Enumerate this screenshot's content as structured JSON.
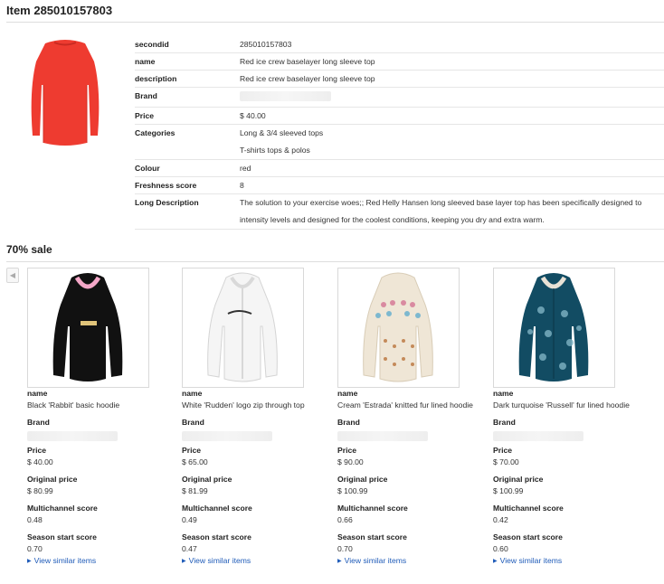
{
  "page": {
    "title": "Item 285010157803"
  },
  "item": {
    "rows": [
      {
        "key": "secondid",
        "value": "285010157803"
      },
      {
        "key": "name",
        "value": "Red ice crew baselayer long sleeve top"
      },
      {
        "key": "description",
        "value": "Red ice crew baselayer long sleeve top"
      },
      {
        "key": "Brand",
        "value": ""
      },
      {
        "key": "Price",
        "value": "$ 40.00"
      },
      {
        "key": "Categories",
        "value": "Long & 3/4 sleeved tops",
        "value2": "T-shirts tops & polos"
      },
      {
        "key": "Colour",
        "value": "red"
      },
      {
        "key": "Freshness score",
        "value": "8"
      },
      {
        "key": "Long Description",
        "value": "The solution to your exercise woes;; Red Helly Hansen long sleeved base layer top has been specifically designed to",
        "value2": "intensity levels and designed for the coolest conditions, keeping you dry and extra warm."
      }
    ]
  },
  "sale": {
    "title": "70% sale",
    "prev_icon": "left-arrow-icon",
    "labels": {
      "name": "name",
      "brand": "Brand",
      "price": "Price",
      "original_price": "Original price",
      "multichannel": "Multichannel score",
      "season": "Season start score",
      "similar": "View similar items"
    },
    "products": [
      {
        "name": "Black 'Rabbit' basic hoodie",
        "price": "$ 40.00",
        "original_price": "$ 80.99",
        "multichannel": "0.48",
        "season": "0.70",
        "color": "#111111",
        "accent": "#f4a7c8"
      },
      {
        "name": "White 'Rudden' logo zip through top",
        "price": "$ 65.00",
        "original_price": "$ 81.99",
        "multichannel": "0.49",
        "season": "0.47",
        "color": "#f5f5f5",
        "accent": "#d9d9d9"
      },
      {
        "name": "Cream 'Estrada' knitted fur lined hoodie",
        "price": "$ 90.00",
        "original_price": "$ 100.99",
        "multichannel": "0.66",
        "season": "0.70",
        "color": "#efe6d6",
        "accent": "#d98aa0"
      },
      {
        "name": "Dark turquoise 'Russell' fur lined hoodie",
        "price": "$ 70.00",
        "original_price": "$ 100.99",
        "multichannel": "0.42",
        "season": "0.60",
        "color": "#124c63",
        "accent": "#7fb3c4"
      }
    ]
  }
}
